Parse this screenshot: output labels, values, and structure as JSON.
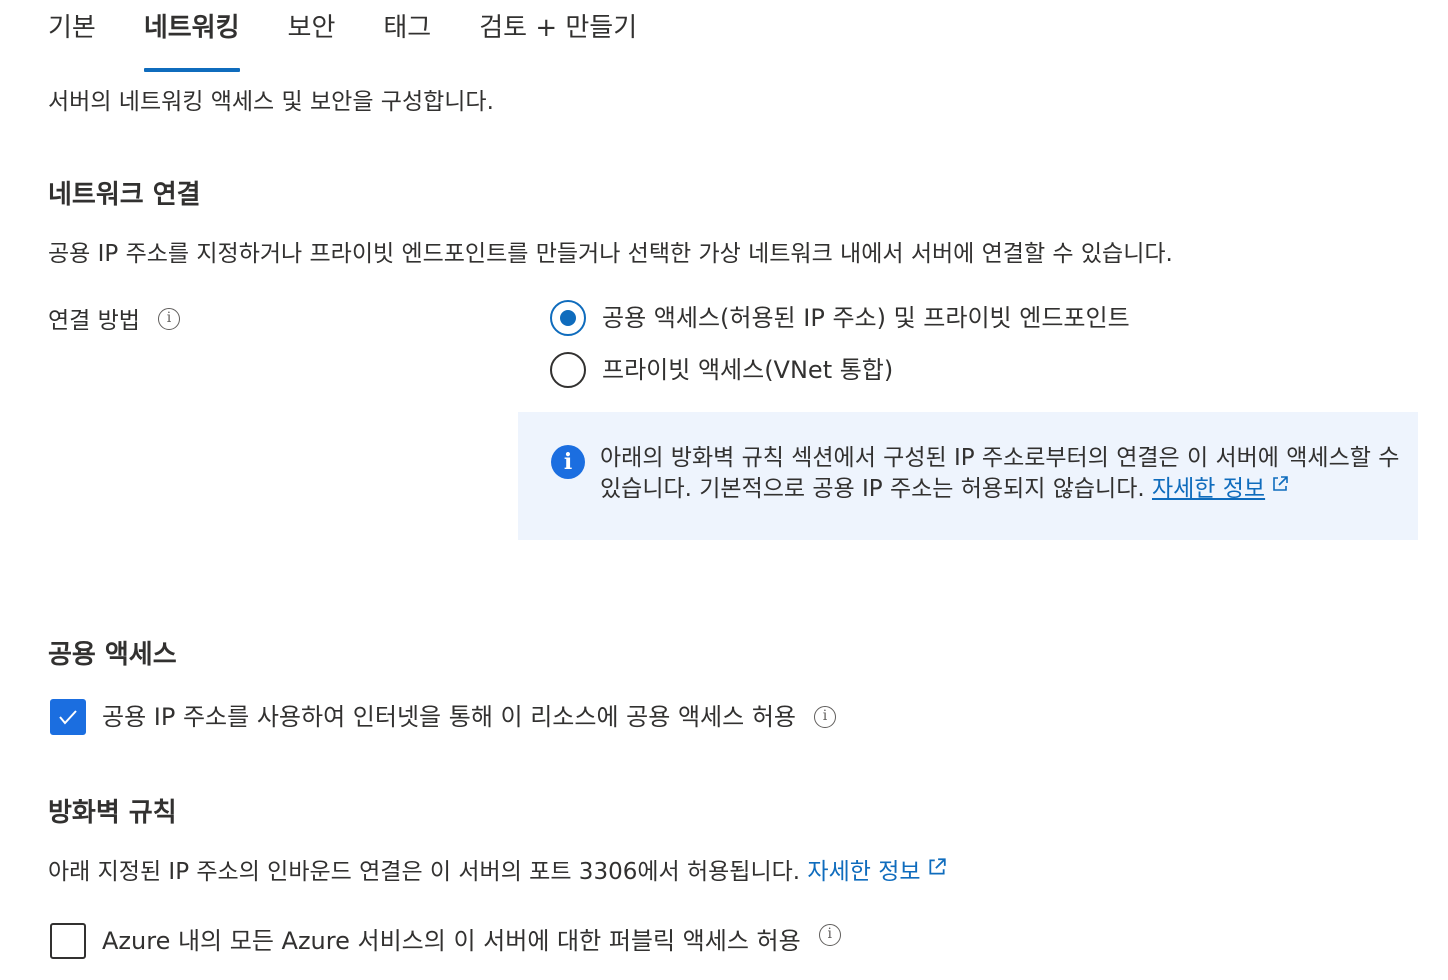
{
  "tabs": [
    {
      "label": "기본",
      "active": false
    },
    {
      "label": "네트워킹",
      "active": true
    },
    {
      "label": "보안",
      "active": false
    },
    {
      "label": "태그",
      "active": false
    },
    {
      "label": "검토 + 만들기",
      "active": false
    }
  ],
  "intro": "서버의 네트워킹 액세스 및 보안을 구성합니다.",
  "network_connection": {
    "heading": "네트워크 연결",
    "description": "공용 IP 주소를 지정하거나 프라이빗 엔드포인트를 만들거나 선택한 가상 네트워크 내에서 서버에 연결할 수 있습니다.",
    "method_label": "연결 방법",
    "options": [
      {
        "label": "공용 액세스(허용된 IP 주소) 및 프라이빗 엔드포인트",
        "selected": true
      },
      {
        "label": "프라이빗 액세스(VNet 통합)",
        "selected": false
      }
    ],
    "banner": {
      "text": "아래의 방화벽 규칙 섹션에서 구성된 IP 주소로부터의 연결은 이 서버에 액세스할 수 있습니다. 기본적으로 공용 IP 주소는 허용되지 않습니다.",
      "link": "자세한 정보"
    }
  },
  "public_access": {
    "heading": "공용 액세스",
    "checkbox_label": "공용 IP 주소를 사용하여 인터넷을 통해 이 리소스에 공용 액세스 허용",
    "checked": true
  },
  "firewall": {
    "heading": "방화벽 규칙",
    "description": "아래 지정된 IP 주소의 인바운드 연결은 이 서버의 포트 3306에서 허용됩니다.",
    "link": "자세한 정보",
    "checkbox_label": "Azure 내의 모든 Azure 서비스의 이 서버에 대한 퍼블릭 액세스 허용",
    "checked": false
  },
  "colors": {
    "accent": "#0f6cbd",
    "banner_bg": "#eef4fd",
    "checkbox_fill": "#1b6ee0",
    "text": "#323130"
  }
}
